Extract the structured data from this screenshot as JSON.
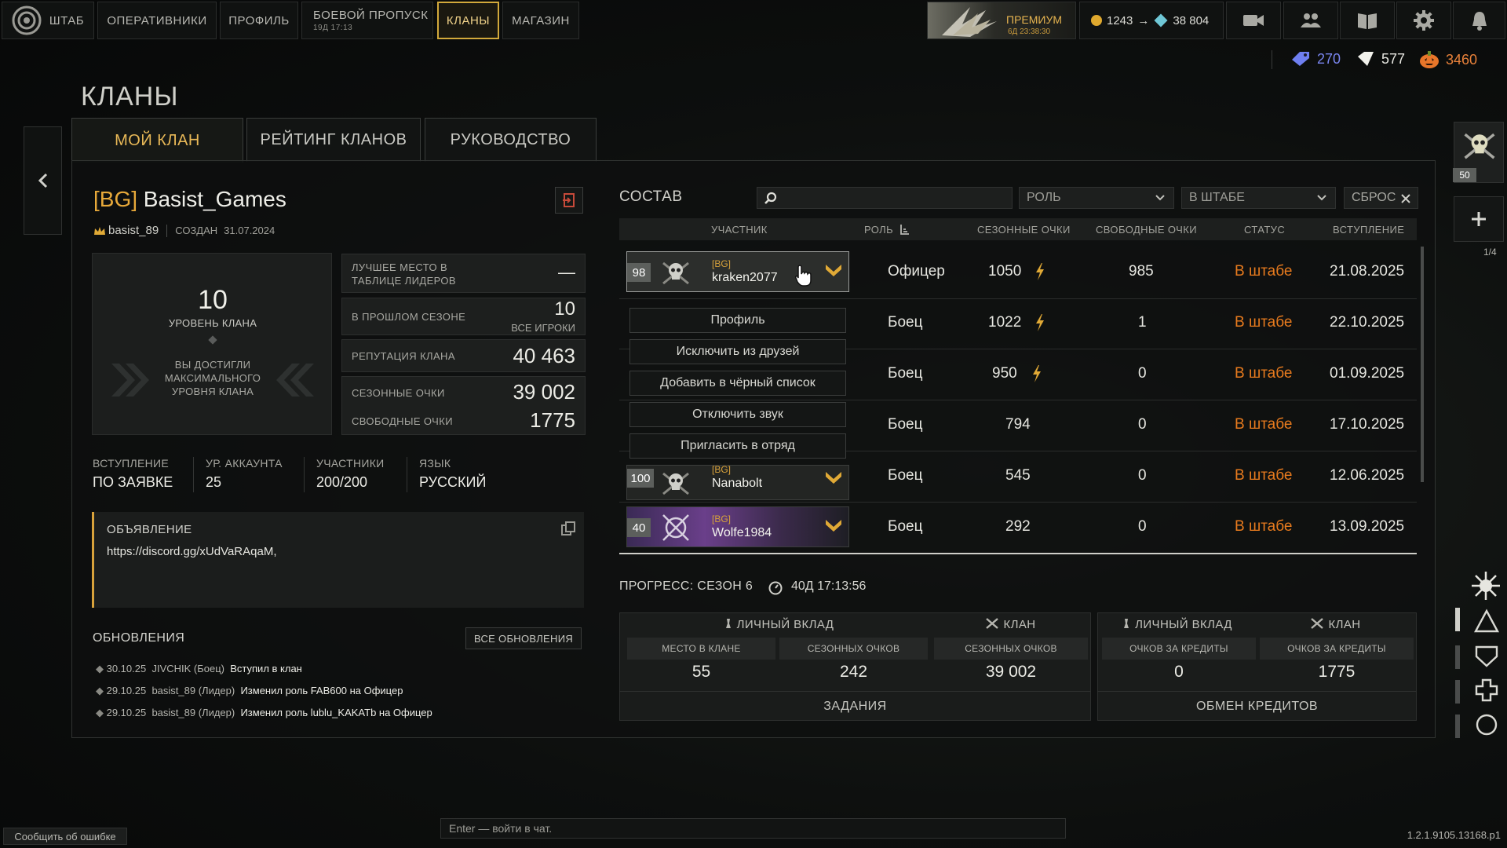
{
  "nav": {
    "home": "ШТАБ",
    "operatives": "ОПЕРАТИВНИКИ",
    "profile": "ПРОФИЛЬ",
    "battlepass": "БОЕВОЙ ПРОПУСК",
    "battlepass_timer": "19Д 17:13",
    "clans": "КЛАНЫ",
    "shop": "МАГАЗИН",
    "premium": "ПРЕМИУМ",
    "premium_timer": "6Д 23:38:30",
    "coins": "1243",
    "arrow": "→",
    "gems": "38 804"
  },
  "currencies": {
    "tickets": "270",
    "diamonds": "577",
    "pumpkins": "3460"
  },
  "page_title": "КЛАНЫ",
  "tabs": [
    "МОЙ КЛАН",
    "РЕЙТИНГ КЛАНОВ",
    "РУКОВОДСТВО"
  ],
  "clan": {
    "tag": "[BG]",
    "name": "Basist_Games",
    "leader": "basist_89",
    "created_label": "СОЗДАН",
    "created": "31.07.2024",
    "level": "10",
    "level_label": "УРОВЕНЬ КЛАНА",
    "max_level_text": "ВЫ ДОСТИГЛИ МАКСИМАЛЬНОГО УРОВНЯ КЛАНА"
  },
  "stats": {
    "best_place_label": "ЛУЧШЕЕ МЕСТО В ТАБЛИЦЕ ЛИДЕРОВ",
    "best_place_value": "—",
    "last_season_label": "В ПРОШЛОМ СЕЗОНЕ",
    "last_season_value": "10",
    "last_season_sub": "ВСЕ ИГРОКИ",
    "reputation_label": "РЕПУТАЦИЯ КЛАНА",
    "reputation_value": "40 463",
    "season_points_label": "СЕЗОННЫЕ ОЧКИ",
    "season_points_value": "39 002",
    "free_points_label": "СВОБОДНЫЕ ОЧКИ",
    "free_points_value": "1775"
  },
  "info": {
    "join_label": "ВСТУПЛЕНИЕ",
    "join_value": "ПО ЗАЯВКЕ",
    "acc_label": "УР. АККАУНТА",
    "acc_value": "25",
    "members_label": "УЧАСТНИКИ",
    "members_value": "200/200",
    "lang_label": "ЯЗЫК",
    "lang_value": "РУССКИЙ"
  },
  "announcement": {
    "title": "ОБЪЯВЛЕНИЕ",
    "text": "https://discord.gg/xUdVaRAqaM,"
  },
  "updates": {
    "title": "ОБНОВЛЕНИЯ",
    "all_button": "ВСЕ ОБНОВЛЕНИЯ",
    "items": [
      {
        "date": "30.10.25",
        "who": "JIVCHIK (Боец)",
        "what": "Вступил в клан"
      },
      {
        "date": "29.10.25",
        "who": "basist_89 (Лидер)",
        "what": "Изменил роль FAB600 на Офицер"
      },
      {
        "date": "29.10.25",
        "who": "basist_89 (Лидер)",
        "what": "Изменил роль lublu_KAKATb на Офицер"
      }
    ]
  },
  "roster": {
    "title": "СОСТАВ",
    "search_placeholder": "",
    "role_filter": "РОЛЬ",
    "location_filter": "В ШТАБЕ",
    "reset": "СБРОС",
    "columns": [
      "УЧАСТНИК",
      "РОЛЬ",
      "СЕЗОННЫЕ ОЧКИ",
      "СВОБОДНЫЕ ОЧКИ",
      "СТАТУС",
      "ВСТУПЛЕНИЕ"
    ],
    "rows": [
      {
        "level": "98",
        "tag": "[BG]",
        "name": "kraken2077",
        "role": "Офицер",
        "season": "1050",
        "bolt": true,
        "free": "985",
        "status": "В штабе",
        "joined": "21.08.2025"
      },
      {
        "level": "",
        "tag": "",
        "name": "",
        "role": "Боец",
        "season": "1022",
        "bolt": true,
        "free": "1",
        "status": "В штабе",
        "joined": "22.10.2025"
      },
      {
        "level": "",
        "tag": "",
        "name": "",
        "role": "Боец",
        "season": "950",
        "bolt": true,
        "free": "0",
        "status": "В штабе",
        "joined": "01.09.2025"
      },
      {
        "level": "",
        "tag": "",
        "name": "",
        "role": "Боец",
        "season": "794",
        "bolt": false,
        "free": "0",
        "status": "В штабе",
        "joined": "17.10.2025"
      },
      {
        "level": "100",
        "tag": "[BG]",
        "name": "Nanabolt",
        "role": "Боец",
        "season": "545",
        "bolt": false,
        "free": "0",
        "status": "В штабе",
        "joined": "12.06.2025"
      },
      {
        "level": "40",
        "tag": "[BG]",
        "name": "Wolfe1984",
        "role": "Боец",
        "season": "292",
        "bolt": false,
        "free": "0",
        "status": "В штабе",
        "joined": "13.09.2025"
      }
    ],
    "context_menu": [
      "Профиль",
      "Исключить из друзей",
      "Добавить в чёрный список",
      "Отключить звук",
      "Пригласить в отряд"
    ]
  },
  "progress": {
    "title": "ПРОГРЕСС: СЕЗОН 6",
    "timer": "40Д 17:13:56",
    "personal_label": "ЛИЧНЫЙ ВКЛАД",
    "clan_label": "КЛАН",
    "place_label": "МЕСТО В КЛАНЕ",
    "place_value": "55",
    "season_label": "СЕЗОННЫХ ОЧКОВ",
    "season_value": "242",
    "clan_season_label": "СЕЗОННЫХ ОЧКОВ",
    "clan_season_value": "39 002",
    "credits_label": "ОЧКОВ ЗА КРЕДИТЫ",
    "credits_value": "0",
    "clan_credits_label": "ОЧКОВ ЗА КРЕДИТЫ",
    "clan_credits_value": "1775",
    "tasks_button": "ЗАДАНИЯ",
    "exchange_button": "ОБМЕН КРЕДИТОВ"
  },
  "side": {
    "badge_level": "50",
    "pager": "1/4"
  },
  "footer": {
    "report": "Сообщить об ошибке",
    "chat_placeholder": "Enter — войти в чат.",
    "version": "1.2.1.9105.13168.p1"
  },
  "colors": {
    "accent": "#e8b857",
    "status": "#e87b1e",
    "tag": "#d8a23b"
  }
}
